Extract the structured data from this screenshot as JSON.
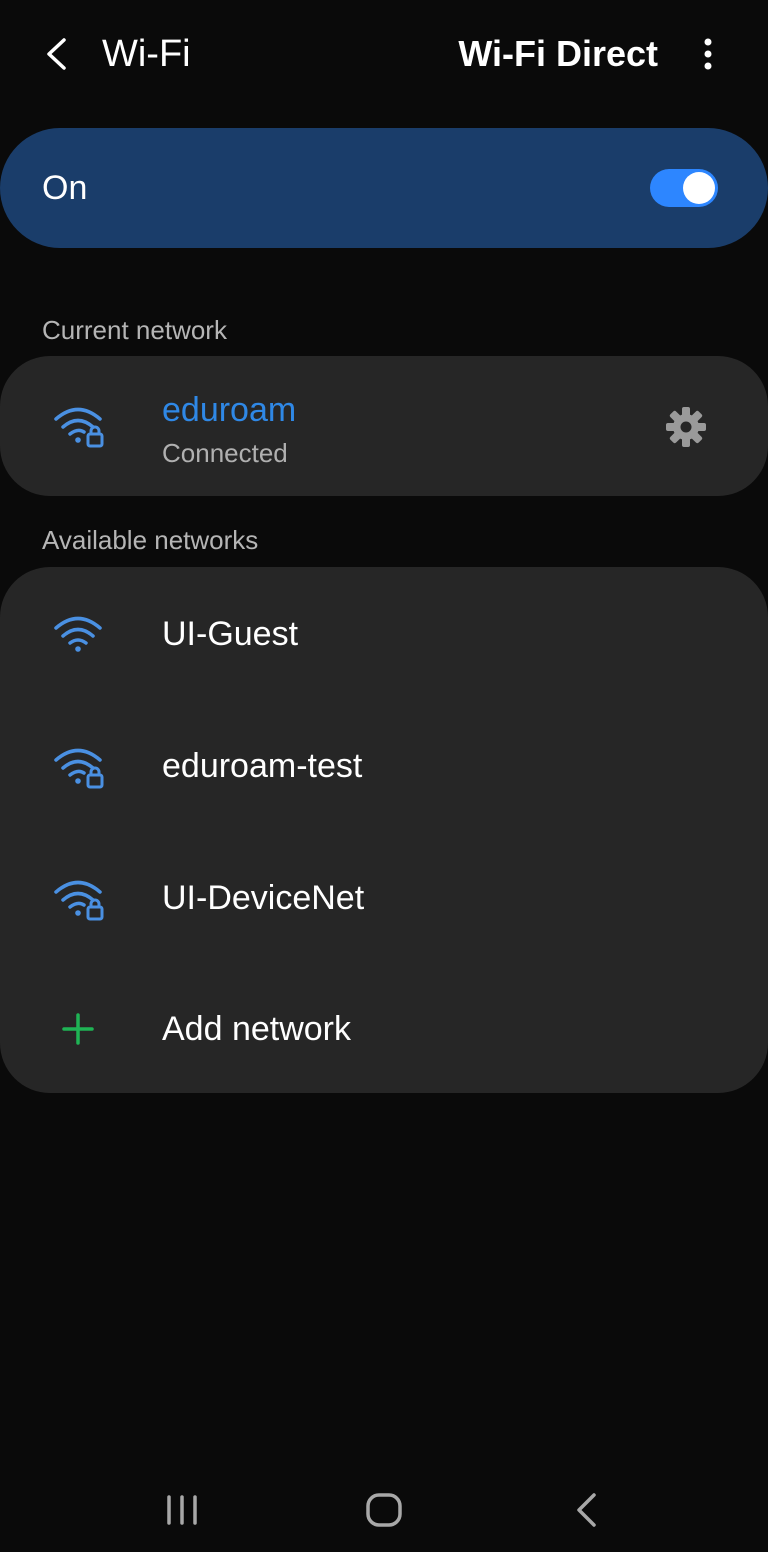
{
  "header": {
    "title": "Wi-Fi",
    "wifi_direct": "Wi-Fi Direct",
    "back_icon": "chevron-left-icon",
    "more_icon": "more-vertical-icon"
  },
  "toggle": {
    "label": "On",
    "state": true
  },
  "current": {
    "section_label": "Current network",
    "network": {
      "name": "eduroam",
      "status": "Connected",
      "icon": "wifi-lock-icon",
      "settings_icon": "gear-icon"
    }
  },
  "available": {
    "section_label": "Available networks",
    "networks": [
      {
        "name": "UI-Guest",
        "icon": "wifi-icon"
      },
      {
        "name": "eduroam-test",
        "icon": "wifi-lock-icon"
      },
      {
        "name": "UI-DeviceNet",
        "icon": "wifi-lock-icon"
      }
    ],
    "add": {
      "label": "Add network",
      "icon": "plus-icon"
    }
  },
  "navbar": {
    "recents_icon": "recents-icon",
    "home_icon": "home-icon",
    "back_icon": "back-icon"
  },
  "colors": {
    "background": "#0a0a0a",
    "card": "#262626",
    "toggle_card": "#1a3d6a",
    "accent": "#2f88e6",
    "switch": "#2d86ff",
    "add_plus": "#1fb455"
  }
}
